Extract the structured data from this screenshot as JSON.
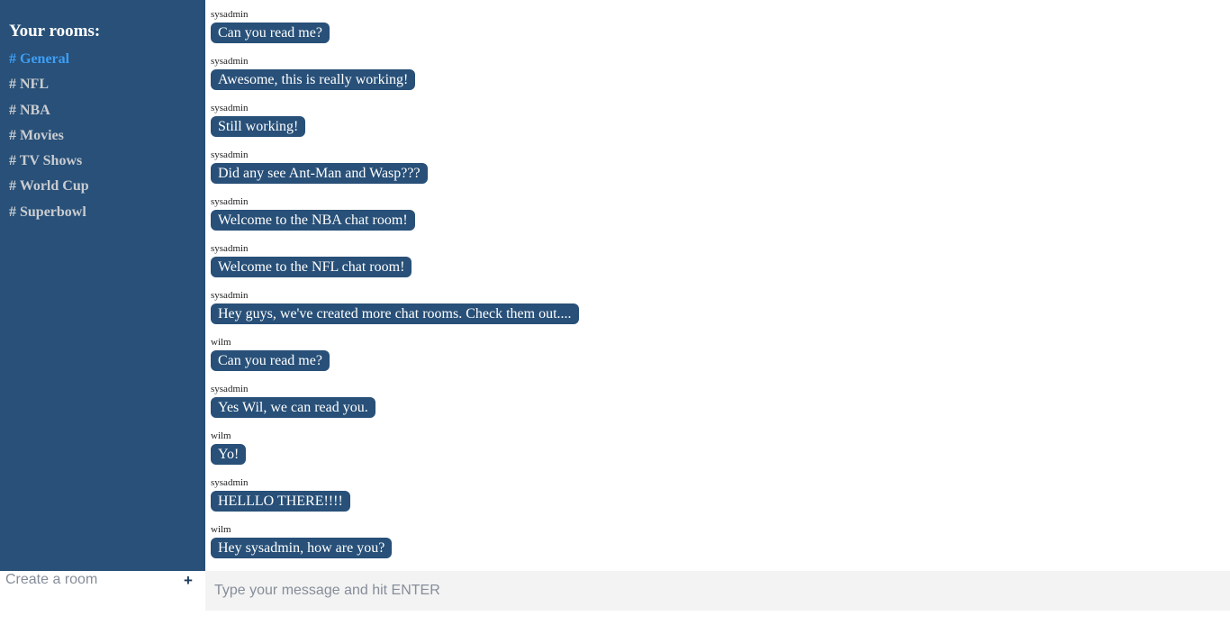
{
  "sidebar": {
    "heading": "Your rooms:",
    "rooms": [
      {
        "label": "# General",
        "active": true
      },
      {
        "label": "# NFL"
      },
      {
        "label": "# NBA"
      },
      {
        "label": "# Movies"
      },
      {
        "label": "# TV Shows"
      },
      {
        "label": "# World Cup"
      },
      {
        "label": "# Superbowl"
      }
    ],
    "create_placeholder": "Create a room",
    "create_button": "+"
  },
  "messages": [
    {
      "user": "sysadmin",
      "text": "Can you read me?"
    },
    {
      "user": "sysadmin",
      "text": "Awesome, this is really working!"
    },
    {
      "user": "sysadmin",
      "text": "Still working!"
    },
    {
      "user": "sysadmin",
      "text": "Did any see Ant-Man and Wasp???"
    },
    {
      "user": "sysadmin",
      "text": "Welcome to the NBA chat room!"
    },
    {
      "user": "sysadmin",
      "text": "Welcome to the NFL chat room!"
    },
    {
      "user": "sysadmin",
      "text": "Hey guys, we've created more chat rooms. Check them out...."
    },
    {
      "user": "wilm",
      "text": "Can you read me?"
    },
    {
      "user": "sysadmin",
      "text": "Yes Wil, we can read you."
    },
    {
      "user": "wilm",
      "text": "Yo!"
    },
    {
      "user": "sysadmin",
      "text": "HELLLO THERE!!!!"
    },
    {
      "user": "wilm",
      "text": "Hey sysadmin, how are you?"
    }
  ],
  "composer": {
    "placeholder": "Type your message and hit ENTER"
  },
  "colors": {
    "sidebar": "#285078",
    "active_room": "#3d9ef5",
    "bubble": "#285078"
  }
}
